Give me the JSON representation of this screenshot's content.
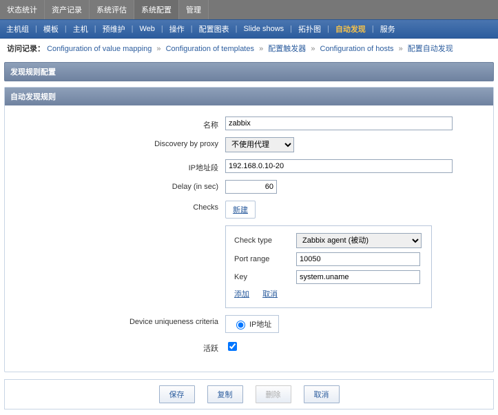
{
  "topTabs": {
    "items": [
      "状态统计",
      "资产记录",
      "系统评估",
      "系统配置",
      "管理"
    ],
    "activeIndex": 3
  },
  "subTabs": {
    "items": [
      "主机组",
      "模板",
      "主机",
      "预维护",
      "Web",
      "操作",
      "配置图表",
      "Slide shows",
      "拓扑图",
      "自动发现",
      "服务"
    ],
    "highlightIndex": 9
  },
  "breadcrumb": {
    "label": "访问记录：",
    "items": [
      "Configuration of value mapping",
      "Configuration of templates",
      "配置触发器",
      "Configuration of hosts",
      "配置自动发现"
    ]
  },
  "pageTitle": "发现规则配置",
  "card": {
    "title": "自动发现规则",
    "fields": {
      "name": {
        "label": "名称",
        "value": "zabbix"
      },
      "proxy": {
        "label": "Discovery by proxy",
        "selected": "不使用代理"
      },
      "iprange": {
        "label": "IP地址段",
        "value": "192.168.0.10-20"
      },
      "delay": {
        "label": "Delay (in sec)",
        "value": "60"
      },
      "checks": {
        "label": "Checks",
        "newLabel": "新建"
      },
      "checkbox": {
        "checkTypeLabel": "Check type",
        "checkTypeValue": "Zabbix agent (被动)",
        "portLabel": "Port range",
        "portValue": "10050",
        "keyLabel": "Key",
        "keyValue": "system.uname",
        "addLabel": "添加",
        "cancelLabel": "取消"
      },
      "uniq": {
        "label": "Device uniqueness criteria",
        "radioLabel": "IP地址"
      },
      "active": {
        "label": "活跃"
      }
    }
  },
  "footer": {
    "save": "保存",
    "copy": "复制",
    "delete": "删除",
    "cancel": "取消"
  }
}
